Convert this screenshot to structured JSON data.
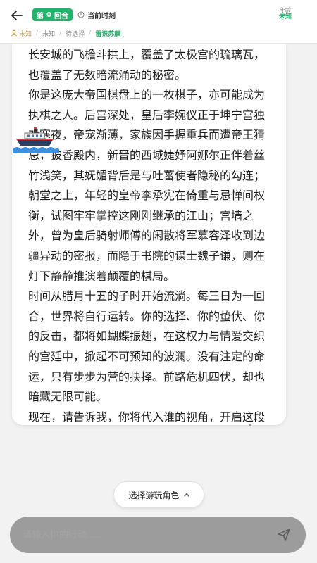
{
  "header": {
    "round_prefix": "第",
    "round_number": "0",
    "round_suffix": "回合",
    "time_label": "当前时刻",
    "age_label": "年龄",
    "age_value": "未知"
  },
  "breadcrumb": [
    "未知",
    "未知",
    "待选择",
    "雷识苏麒"
  ],
  "message": {
    "paragraphs": [
      "长安城的飞檐斗拱上，覆盖了太极宫的琉璃瓦，也覆盖了无数暗流涌动的秘密。",
      "你是这庞大帝国棋盘上的一枚棋子，亦可能成为执棋之人。后宫深处，皇后李婉仪正于坤宁宫独对寒夜，帝宠渐薄，家族因手握重兵而遭帝王猜忌，披香殿内，新晋的西域婕妤阿娜尔正伴着丝竹浅笑，其妩媚背后是与吐蕃使者隐秘的勾连；朝堂之上，年轻的皇帝李承宪在倚重与忌惮间权衡，试图牢牢掌控这刚刚继承的江山；宫墙之外，曾为皇后骑射师傅的闲散将军慕容泽收到边疆异动的密报，而隐于书院的谋士魏子谦，则在灯下静静推演着颠覆的棋局。",
      "时间从腊月十五的子时开始流淌。每三日为一回合，世界将自行运转。你的选择、你的蛰伏、你的反击，都将如蝴蝶振翅，在这权力与情爱交织的宫廷中，掀起不可预知的波澜。没有注定的命运，只有步步为营的抉择。前路危机四伏，却也暗藏无限可能。",
      "现在，请告诉我，你将代入谁的视角，开启这段属于大唐的人生?"
    ]
  },
  "role_button": {
    "label": "选择游玩角色"
  },
  "input": {
    "placeholder": "请输入你的行动……"
  },
  "icons": {
    "back": "arrow-left-icon",
    "clock": "clock-icon",
    "user": "user-icon",
    "ship": "ship-icon",
    "chevron": "chevron-up-icon",
    "send": "send-icon"
  },
  "colors": {
    "accent": "#23b26b",
    "user_crumb": "#e0a23a"
  }
}
